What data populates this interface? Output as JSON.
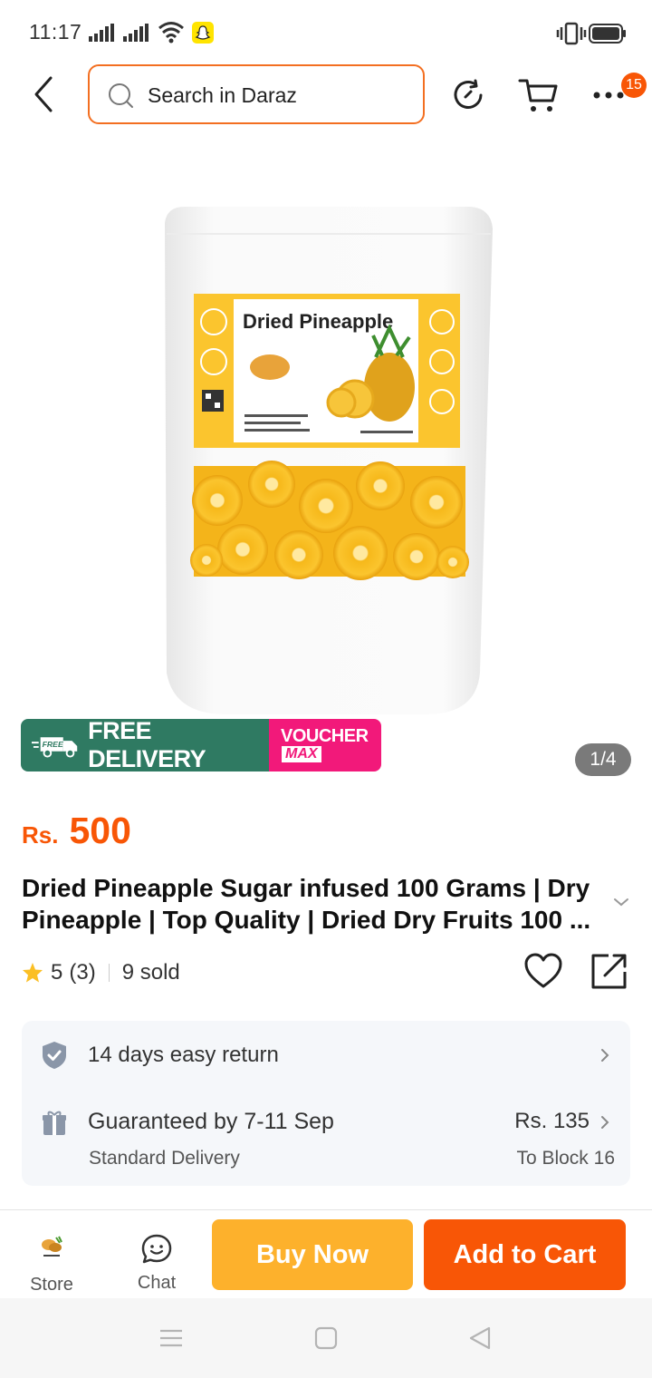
{
  "status_bar": {
    "time": "11:17"
  },
  "header": {
    "search_placeholder": "Search in Daraz",
    "cart_badge": "15"
  },
  "product": {
    "image_alt": "Dried Pineapple",
    "image_counter": "1/4",
    "promo": {
      "free_delivery": "FREE DELIVERY",
      "voucher_top": "VOUCHER",
      "voucher_bottom": "MAX"
    },
    "price_currency": "Rs.",
    "price_value": "500",
    "title": "Dried Pineapple Sugar infused 100 Grams | Dry Pineapple | Top Quality | Dried Dry Fruits 100 ...",
    "rating": "5",
    "rating_count": "(3)",
    "sold": "9 sold"
  },
  "services": {
    "return_text": "14 days easy return",
    "delivery_title": "Guaranteed by 7-11 Sep",
    "delivery_type": "Standard Delivery",
    "delivery_price": "Rs. 135",
    "delivery_to": "To Block 16"
  },
  "actions": {
    "store_label": "Store",
    "chat_label": "Chat",
    "buy_now": "Buy Now",
    "add_to_cart": "Add to Cart"
  },
  "colors": {
    "accent": "#f85606",
    "buy_now": "#fdb12c",
    "free_delivery": "#2f7a62",
    "voucher": "#f2197a"
  }
}
